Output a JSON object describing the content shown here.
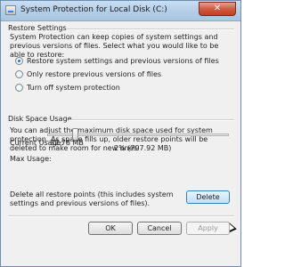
{
  "window": {
    "title": "System Protection for Local Disk (C:)",
    "close_glyph": "✕"
  },
  "restore_settings": {
    "heading": "Restore Settings",
    "description": "System Protection can keep copies of system settings and previous versions of files. Select what you would like to be able to restore:",
    "options": [
      {
        "label": "Restore system settings and previous versions of files",
        "selected": true
      },
      {
        "label": "Only restore previous versions of files",
        "selected": false
      },
      {
        "label": "Turn off system protection",
        "selected": false
      }
    ]
  },
  "disk_space": {
    "heading": "Disk Space Usage",
    "description": "You can adjust the maximum disk space used for system protection. As space fills up, older restore points will be deleted to make room for new ones.",
    "current_usage_label": "Current Usage:",
    "current_usage_value": "32.78 MB",
    "max_usage_label": "Max Usage:",
    "max_usage_readout": "2% (797.92 MB)",
    "max_usage_fraction": 0.02
  },
  "delete": {
    "description": "Delete all restore points (this includes system settings and previous versions of files).",
    "button_label": "Delete"
  },
  "footer": {
    "ok_label": "OK",
    "cancel_label": "Cancel",
    "apply_label": "Apply"
  },
  "colors": {
    "accent": "#2b6ed6",
    "close_button": "#c23f22"
  },
  "icons": [
    "drive-icon",
    "close-icon",
    "mouse-cursor-icon"
  ]
}
